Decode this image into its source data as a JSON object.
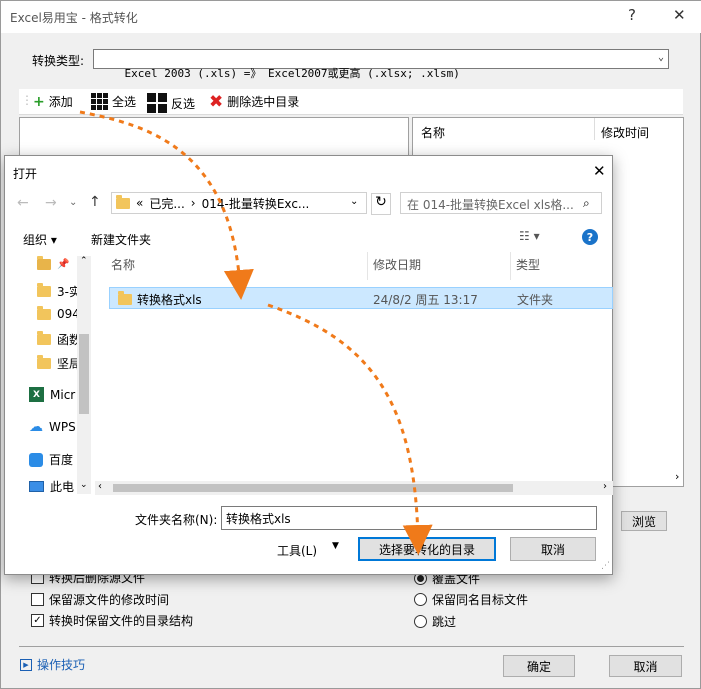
{
  "window": {
    "title": "Excel易用宝 - 格式转化",
    "help_glyph": "?",
    "close_glyph": "✕"
  },
  "convert": {
    "label": "转换类型:",
    "value": "Excel 2003 (.xls) =》 Excel2007或更高 (.xlsx; .xlsm)"
  },
  "toolbar": {
    "add": "添加",
    "select_all": "全选",
    "invert": "反选",
    "remove": "删除选中目录"
  },
  "right_list": {
    "col_name": "名称",
    "col_modified": "修改时间"
  },
  "browse_button": "浏览",
  "options_left": [
    {
      "label": "转换后删除源文件",
      "checked": false
    },
    {
      "label": "保留源文件的修改时间",
      "checked": false
    },
    {
      "label": "转换时保留文件的目录结构",
      "checked": true
    }
  ],
  "options_right": [
    {
      "label": "覆盖文件",
      "selected": true
    },
    {
      "label": "保留同名目标文件",
      "selected": false
    },
    {
      "label": "跳过",
      "selected": false
    }
  ],
  "tips_link": "操作技巧",
  "ok_button": "确定",
  "cancel_button": "取消",
  "dialog": {
    "title": "打开",
    "close_glyph": "✕",
    "address": {
      "chevrons": "«",
      "segment1": "已完...",
      "separator": "›",
      "segment2": "014-批量转换Exc..."
    },
    "search_placeholder": "在 014-批量转换Excel xls格...",
    "organize": "组织 ▾",
    "new_folder": "新建文件夹",
    "sidebar": [
      {
        "label": "",
        "icon": "folder-pinned"
      },
      {
        "label": "3-实",
        "icon": "folder"
      },
      {
        "label": "094",
        "icon": "folder"
      },
      {
        "label": "函数",
        "icon": "folder"
      },
      {
        "label": "坚局",
        "icon": "folder"
      },
      {
        "label": "Micr",
        "icon": "excel"
      },
      {
        "label": "WPS",
        "icon": "cloud"
      },
      {
        "label": "百度",
        "icon": "baidu"
      },
      {
        "label": "此电",
        "icon": "pc"
      }
    ],
    "columns": {
      "name": "名称",
      "date": "修改日期",
      "type": "类型"
    },
    "rows": [
      {
        "name": "转换格式xls",
        "date": "24/8/2 周五 13:17",
        "type": "文件夹"
      }
    ],
    "filename_label": "文件夹名称(N):",
    "filename_value": "转换格式xls",
    "tools": "工具(L)",
    "select_button": "选择要转化的目录",
    "cancel_button": "取消"
  },
  "colors": {
    "accent": "#0078d7",
    "selection": "#cce8ff",
    "arrow": "#f07a1a"
  }
}
